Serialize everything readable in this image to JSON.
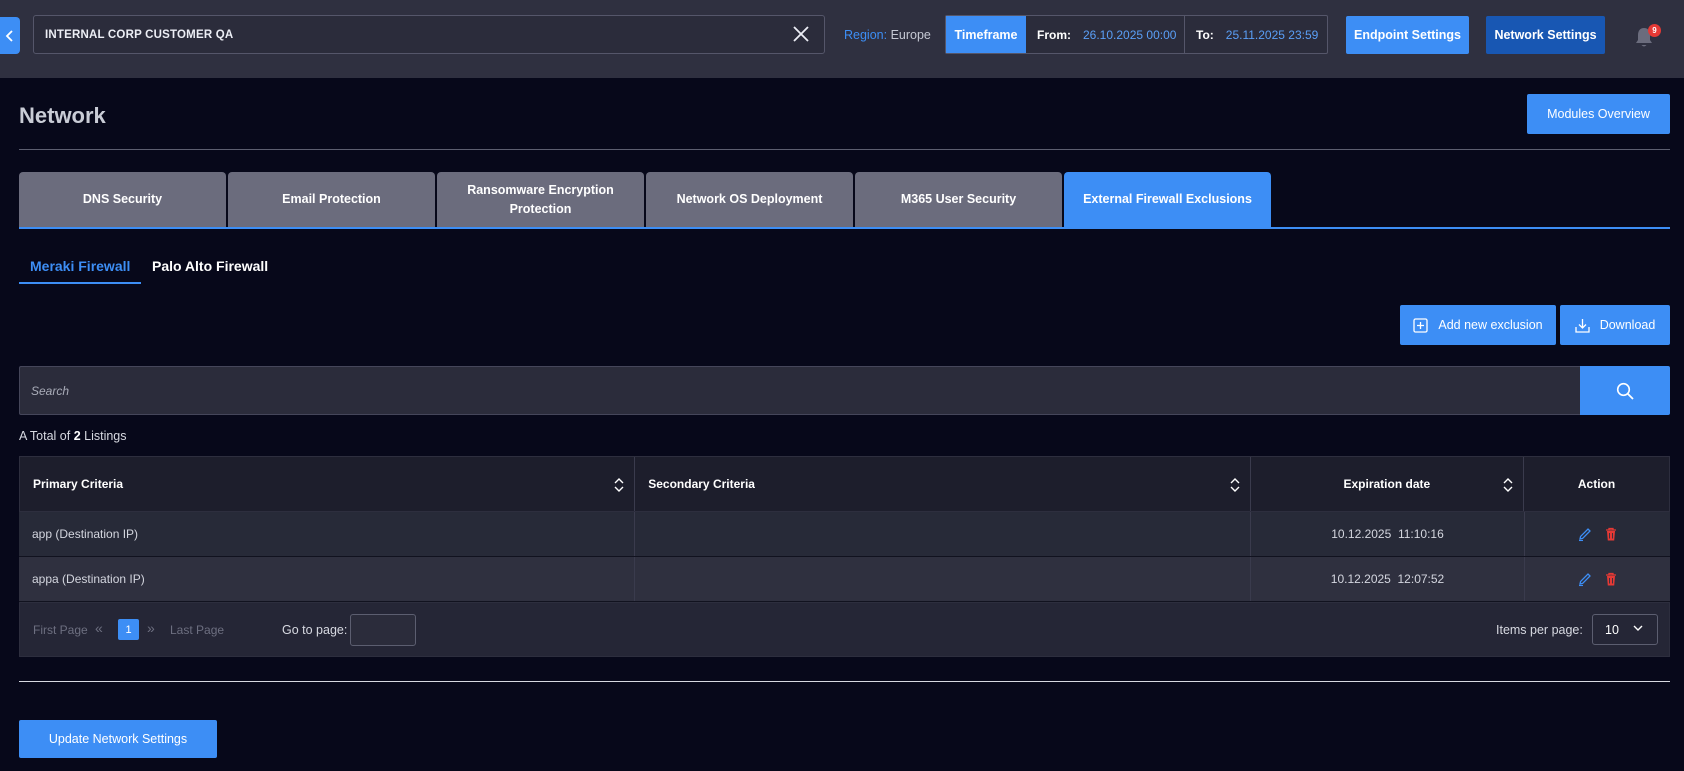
{
  "header": {
    "customer": "INTERNAL CORP CUSTOMER QA",
    "region_label": "Region:",
    "region_value": "Europe",
    "timeframe_label": "Timeframe",
    "from_label": "From:",
    "from_value": "26.10.2025 00:00",
    "to_label": "To:",
    "to_value": "25.11.2025 23:59",
    "endpoint_settings": "Endpoint Settings",
    "network_settings": "Network Settings",
    "notification_count": "9"
  },
  "page": {
    "title": "Network",
    "modules_overview": "Modules Overview"
  },
  "module_tabs": [
    {
      "label": "DNS Security"
    },
    {
      "label": "Email Protection"
    },
    {
      "label": "Ransomware Encryption Protection"
    },
    {
      "label": "Network OS Deployment"
    },
    {
      "label": "M365 User Security"
    },
    {
      "label": "External Firewall Exclusions"
    }
  ],
  "sub_tabs": {
    "meraki": "Meraki Firewall",
    "palo_alto": "Palo Alto Firewall"
  },
  "actions": {
    "add_new": "Add new exclusion",
    "download": "Download"
  },
  "search": {
    "placeholder": "Search"
  },
  "listing": {
    "prefix": "A Total of",
    "count": "2",
    "suffix": "Listings"
  },
  "table": {
    "headers": {
      "primary": "Primary Criteria",
      "secondary": "Secondary Criteria",
      "expiration": "Expiration date",
      "action": "Action"
    },
    "rows": [
      {
        "primary": "app (Destination IP)",
        "secondary": "",
        "expiration": "10.12.2025  11:10:16"
      },
      {
        "primary": "appa (Destination IP)",
        "secondary": "",
        "expiration": "10.12.2025  12:07:52"
      }
    ]
  },
  "pagination": {
    "first": "First Page",
    "prev": "«",
    "current": "1",
    "next": "»",
    "last": "Last Page",
    "goto_label": "Go to page:",
    "items_label": "Items per page:",
    "items_value": "10"
  },
  "footer": {
    "update": "Update Network Settings"
  },
  "colors": {
    "accent": "#3d8ef5",
    "network_settings_active": "#1857b3",
    "delete": "#e53935",
    "background": "#07081a"
  }
}
